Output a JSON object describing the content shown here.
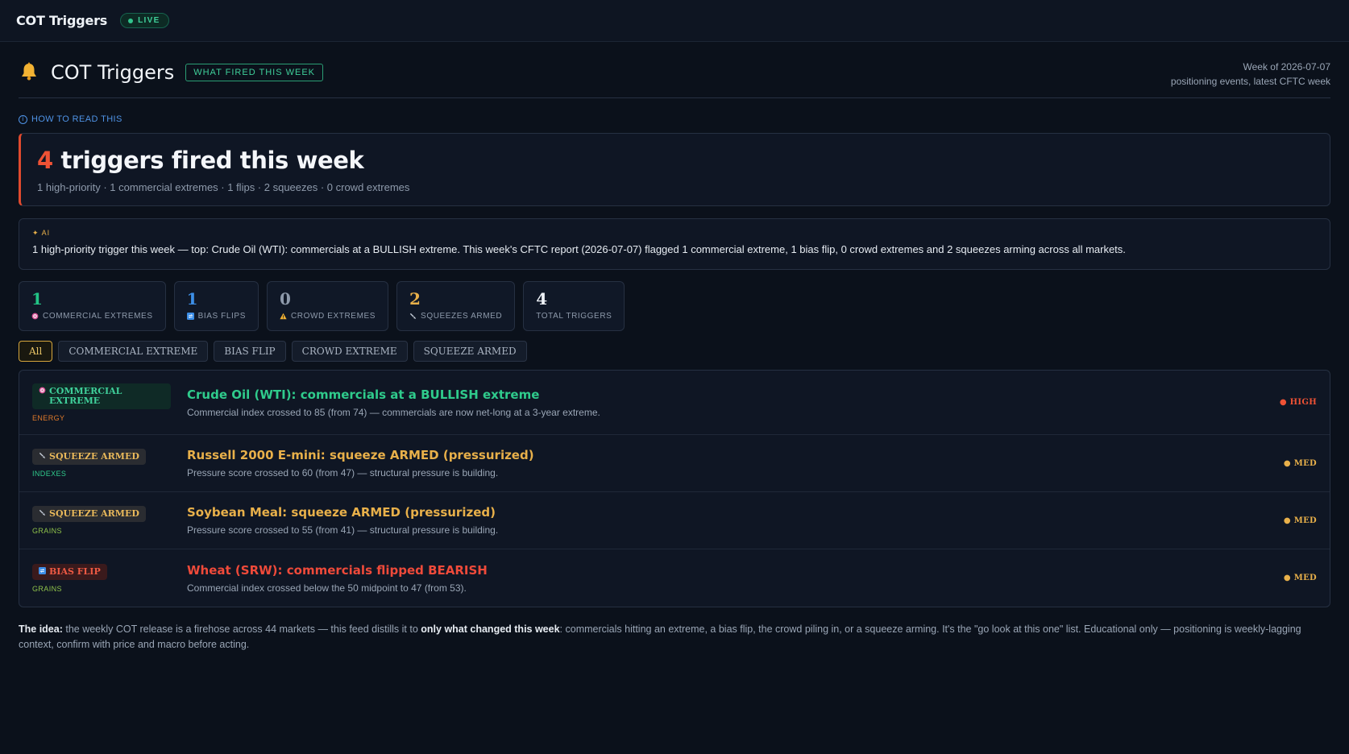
{
  "app": {
    "title": "COT Triggers",
    "live_label": "LIVE"
  },
  "header": {
    "title": "COT Triggers",
    "tag": "WHAT FIRED THIS WEEK",
    "week": "Week of 2026-07-07",
    "subtitle": "positioning events, latest CFTC week"
  },
  "howto_label": "HOW TO READ THIS",
  "hero": {
    "count": "4",
    "title_rest": " triggers fired this week",
    "summary": "1 high-priority · 1 commercial extremes · 1 flips · 2 squeezes · 0 crowd extremes"
  },
  "ai": {
    "label": "AI",
    "text": "1 high-priority trigger this week — top: Crude Oil (WTI): commercials at a BULLISH extreme. This week's CFTC report (2026-07-07) flagged 1 commercial extreme, 1 bias flip, 0 crowd extremes and 2 squeezes arming across all markets."
  },
  "stats": [
    {
      "value": "1",
      "label": "COMMERCIAL EXTREMES",
      "icon": "target-icon",
      "color": "#22c486"
    },
    {
      "value": "1",
      "label": "BIAS FLIPS",
      "icon": "flip-icon",
      "color": "#3d8fe8"
    },
    {
      "value": "0",
      "label": "CROWD EXTREMES",
      "icon": "warning-icon",
      "color": "#8e9aab"
    },
    {
      "value": "2",
      "label": "SQUEEZES ARMED",
      "icon": "squeeze-icon",
      "color": "#e8b04a"
    },
    {
      "value": "4",
      "label": "TOTAL TRIGGERS",
      "icon": "",
      "color": "#eef2f7"
    }
  ],
  "filters": [
    "All",
    "COMMERCIAL EXTREME",
    "BIAS FLIP",
    "CROWD EXTREME",
    "SQUEEZE ARMED"
  ],
  "triggers": [
    {
      "type": "COMMERCIAL EXTREME",
      "type_line1": "COMMERCIAL",
      "type_line2": "EXTREME",
      "category": "ENERGY",
      "category_color": "#e07a2a",
      "title": "Crude Oil (WTI): commercials at a BULLISH extreme",
      "title_color": "#2fcb8c",
      "desc": "Commercial index crossed to 85 (from 74) — commercials are now net-long at a 3-year extreme.",
      "severity": "HIGH",
      "severity_color": "#ef5235"
    },
    {
      "type": "SQUEEZE ARMED",
      "category": "INDEXES",
      "category_color": "#2fcb8c",
      "title": "Russell 2000 E-mini: squeeze ARMED (pressurized)",
      "title_color": "#e8b04a",
      "desc": "Pressure score crossed to 60 (from 47) — structural pressure is building.",
      "severity": "MED",
      "severity_color": "#e8b04a"
    },
    {
      "type": "SQUEEZE ARMED",
      "category": "GRAINS",
      "category_color": "#8fc24a",
      "title": "Soybean Meal: squeeze ARMED (pressurized)",
      "title_color": "#e8b04a",
      "desc": "Pressure score crossed to 55 (from 41) — structural pressure is building.",
      "severity": "MED",
      "severity_color": "#e8b04a"
    },
    {
      "type": "BIAS FLIP",
      "category": "GRAINS",
      "category_color": "#8fc24a",
      "title": "Wheat (SRW): commercials flipped BEARISH",
      "title_color": "#ef4a3a",
      "desc": "Commercial index crossed below the 50 midpoint to 47 (from 53).",
      "severity": "MED",
      "severity_color": "#e8b04a"
    }
  ],
  "footer": {
    "lead": "The idea:",
    "part1": " the weekly COT release is a firehose across 44 markets — this feed distills it to ",
    "bold": "only what changed this week",
    "part2": ": commercials hitting an extreme, a bias flip, the crowd piling in, or a squeeze arming. It's the \"go look at this one\" list. Educational only — positioning is weekly-lagging context, confirm with price and macro before acting."
  }
}
